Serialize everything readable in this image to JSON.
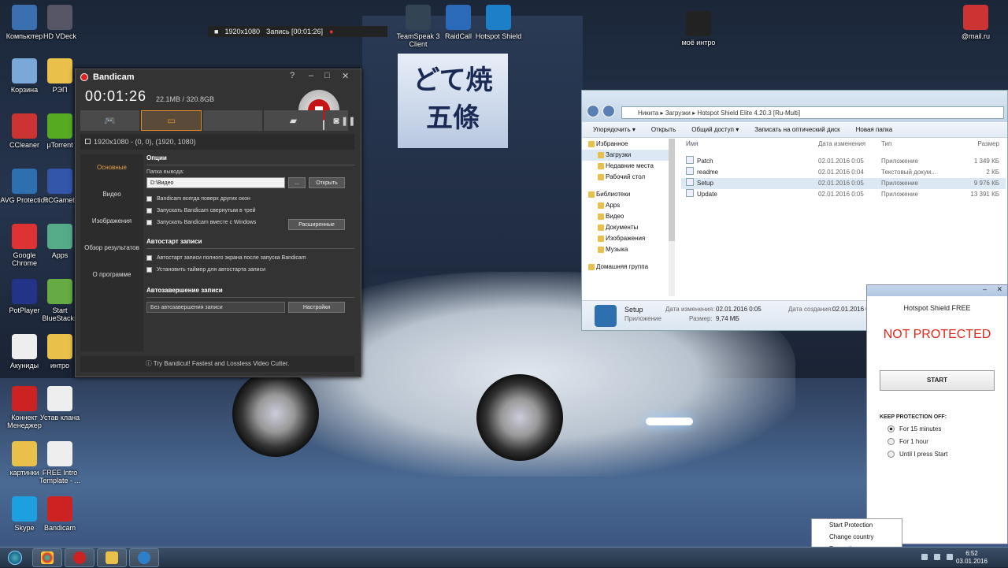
{
  "desktop": {
    "icons": [
      {
        "label": "Компьютер"
      },
      {
        "label": "HD VDeck"
      },
      {
        "label": "TeamSpeak 3 Client"
      },
      {
        "label": "RaidCall"
      },
      {
        "label": "Hotspot Shield"
      },
      {
        "label": "моё интро"
      },
      {
        "label": "@mail.ru"
      },
      {
        "label": "Корзина"
      },
      {
        "label": "РЭП"
      },
      {
        "label": "CCleaner"
      },
      {
        "label": "µTorrent"
      },
      {
        "label": "AVG Protection"
      },
      {
        "label": "RCGameb"
      },
      {
        "label": "Google Chrome"
      },
      {
        "label": "Apps"
      },
      {
        "label": "PotPlayer"
      },
      {
        "label": "Start BlueStacks"
      },
      {
        "label": "Акуниды"
      },
      {
        "label": "интро"
      },
      {
        "label": "Коннект Менеджер"
      },
      {
        "label": "Устав клана"
      },
      {
        "label": "картинки"
      },
      {
        "label": "FREE Intro Template - ..."
      },
      {
        "label": "Skype"
      },
      {
        "label": "Bandicam"
      }
    ]
  },
  "recording_bar": {
    "resolution": "1920x1080",
    "status": "Запись [00:01:26]"
  },
  "bandicam": {
    "title": "Bandicam",
    "timer": "00:01:26",
    "size": "22.1MB / 320.8GB",
    "mode": "1920x1080 - (0, 0), (1920, 1080)",
    "side_menu": [
      "Основные",
      "Видео",
      "Изображения",
      "Обзор результатов",
      "О программе"
    ],
    "options_title": "Опции",
    "output_label": "Папка вывода:",
    "output_path": "D:\\Видео",
    "browse_label": "...",
    "open_label": "Открыть",
    "checkboxes": [
      "Bandicam всегда поверх других окон",
      "Запускать Bandicam свернутым в трей",
      "Запускать Bandicam вместе с Windows"
    ],
    "advanced_label": "Расширенные",
    "autostart_title": "Автостарт записи",
    "autostart_options": [
      "Автостарт записи полного экрана после запуска Bandicam",
      "Установить таймер для автостарта записи"
    ],
    "autoend_title": "Автозавершение записи",
    "autoend_value": "Без автозавершения записи",
    "settings_label": "Настройки",
    "footer": "Try Bandicut! Fastest and Lossless Video Cutter."
  },
  "explorer": {
    "path": "Никита  ▸  Загрузки  ▸  Hotspot Shield Elite 4.20.3 [Ru-Multi]",
    "toolbar": [
      "Упорядочить ▾",
      "Открыть",
      "Общий доступ ▾",
      "Записать на оптический диск",
      "Новая папка"
    ],
    "nav": [
      {
        "label": "Избранное",
        "group": true
      },
      {
        "label": "Загрузки",
        "selected": true
      },
      {
        "label": "Недавние места"
      },
      {
        "label": "Рабочий стол"
      },
      {
        "label": "Библиотеки",
        "group": true
      },
      {
        "label": "Apps"
      },
      {
        "label": "Видео"
      },
      {
        "label": "Документы"
      },
      {
        "label": "Изображения"
      },
      {
        "label": "Музыка"
      },
      {
        "label": "Домашняя группа",
        "group": true
      }
    ],
    "columns": [
      "Имя",
      "Дата изменения",
      "Тип",
      "Размер"
    ],
    "files": [
      {
        "name": "Patch",
        "date": "02.01.2016 0:05",
        "type": "Приложение",
        "size": "1 349 КБ"
      },
      {
        "name": "readme",
        "date": "02.01.2016 0:04",
        "type": "Текстовый докум...",
        "size": "2 КБ"
      },
      {
        "name": "Setup",
        "date": "02.01.2016 0:05",
        "type": "Приложение",
        "size": "9 976 КБ",
        "selected": true
      },
      {
        "name": "Update",
        "date": "02.01.2016 0:05",
        "type": "Приложение",
        "size": "13 391 КБ"
      }
    ],
    "details": {
      "name": "Setup",
      "kind": "Приложение",
      "modified_label": "Дата изменения:",
      "modified": "02.01.2016 0:05",
      "size_label": "Размер:",
      "size": "9,74 МБ",
      "created_label": "Дата создания:",
      "created": "02.01.2016 0:"
    }
  },
  "hotspot": {
    "title": "Hotspot Shield FREE",
    "status": "NOT PROTECTED",
    "start_label": "START",
    "keep_title": "KEEP PROTECTION OFF:",
    "options": [
      {
        "label": "For 15 minutes",
        "checked": true
      },
      {
        "label": "For 1 hour",
        "checked": false
      },
      {
        "label": "Until I press Start",
        "checked": false
      }
    ]
  },
  "context_menu": [
    "Start Protection",
    "Change country",
    "Properties"
  ],
  "taskbar": {
    "time": "6:52",
    "date": "03.01.2016"
  }
}
